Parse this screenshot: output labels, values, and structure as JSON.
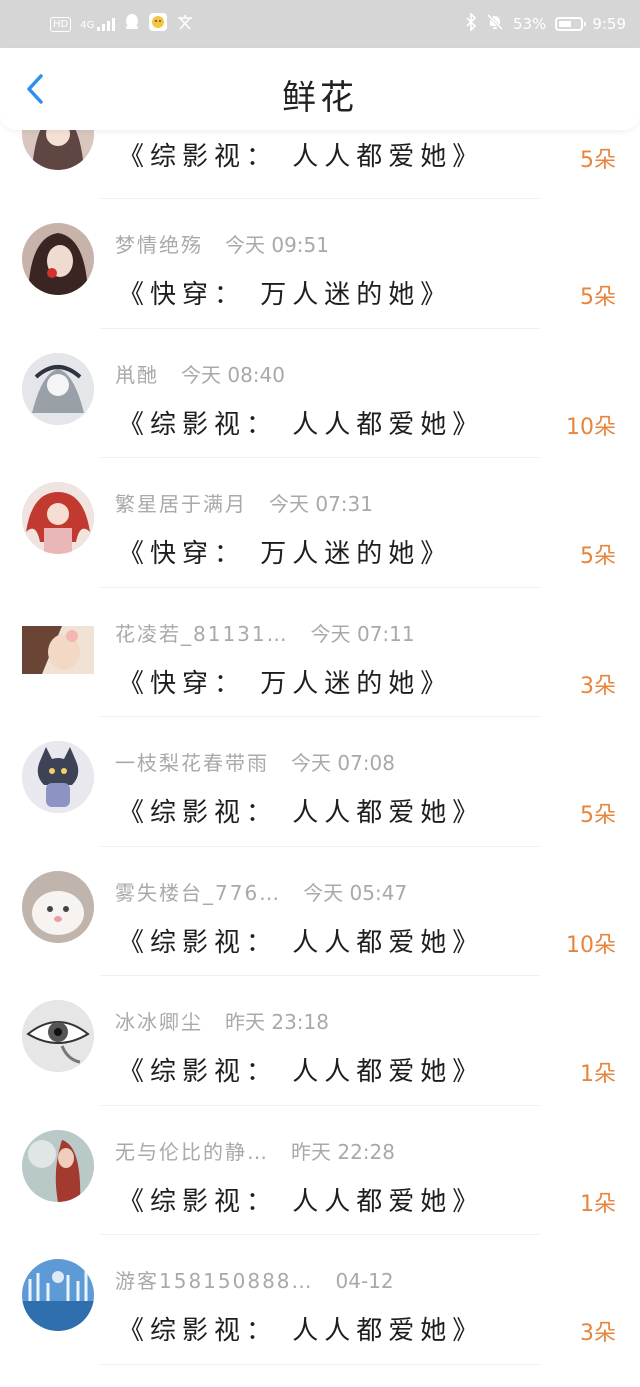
{
  "status": {
    "left_icons": [
      "hd-icon",
      "4g-signal-icon",
      "qq-penguin-icon",
      "app-face-icon",
      "text-icon"
    ],
    "battery": "53%",
    "time": "9:59",
    "hd_label": "HD",
    "net_label": "4G"
  },
  "header": {
    "title": "鲜花"
  },
  "rows": [
    {
      "name": "",
      "time": "",
      "book": "《综影视： 人人都爱她》",
      "flowers": "5朵",
      "avatar": "#8a5a52"
    },
    {
      "name": "梦情绝殇",
      "time": "今天 09:51",
      "book": "《快穿： 万人迷的她》",
      "flowers": "5朵",
      "avatar": "#6e4a44"
    },
    {
      "name": "鼡酏",
      "time": "今天 08:40",
      "book": "《综影视： 人人都爱她》",
      "flowers": "10朵",
      "avatar": "#c9cbd0"
    },
    {
      "name": "繁星居于满月",
      "time": "今天 07:31",
      "book": "《快穿： 万人迷的她》",
      "flowers": "5朵",
      "avatar": "#c0423a"
    },
    {
      "name": "花凌若_81131…",
      "time": "今天 07:11",
      "book": "《快穿： 万人迷的她》",
      "flowers": "3朵",
      "avatar": "#d8b392"
    },
    {
      "name": "一枝梨花春带雨",
      "time": "今天 07:08",
      "book": "《综影视： 人人都爱她》",
      "flowers": "5朵",
      "avatar": "#7b86a8"
    },
    {
      "name": "雾失楼台_776…",
      "time": "今天 05:47",
      "book": "《综影视： 人人都爱她》",
      "flowers": "10朵",
      "avatar": "#d9cfc8"
    },
    {
      "name": "冰冰卿尘",
      "time": "昨天 23:18",
      "book": "《综影视： 人人都爱她》",
      "flowers": "1朵",
      "avatar": "#9a9a9a"
    },
    {
      "name": "无与伦比的静…",
      "time": "昨天 22:28",
      "book": "《综影视： 人人都爱她》",
      "flowers": "1朵",
      "avatar": "#b07a6a"
    },
    {
      "name": "游客158150888…",
      "time": "04-12",
      "book": "《综影视： 人人都爱她》",
      "flowers": "3朵",
      "avatar": "#4a86c6"
    }
  ],
  "colors": {
    "accent": "#2f8ff0",
    "flowers": "#e8843c",
    "meta": "#a9a9a9"
  }
}
